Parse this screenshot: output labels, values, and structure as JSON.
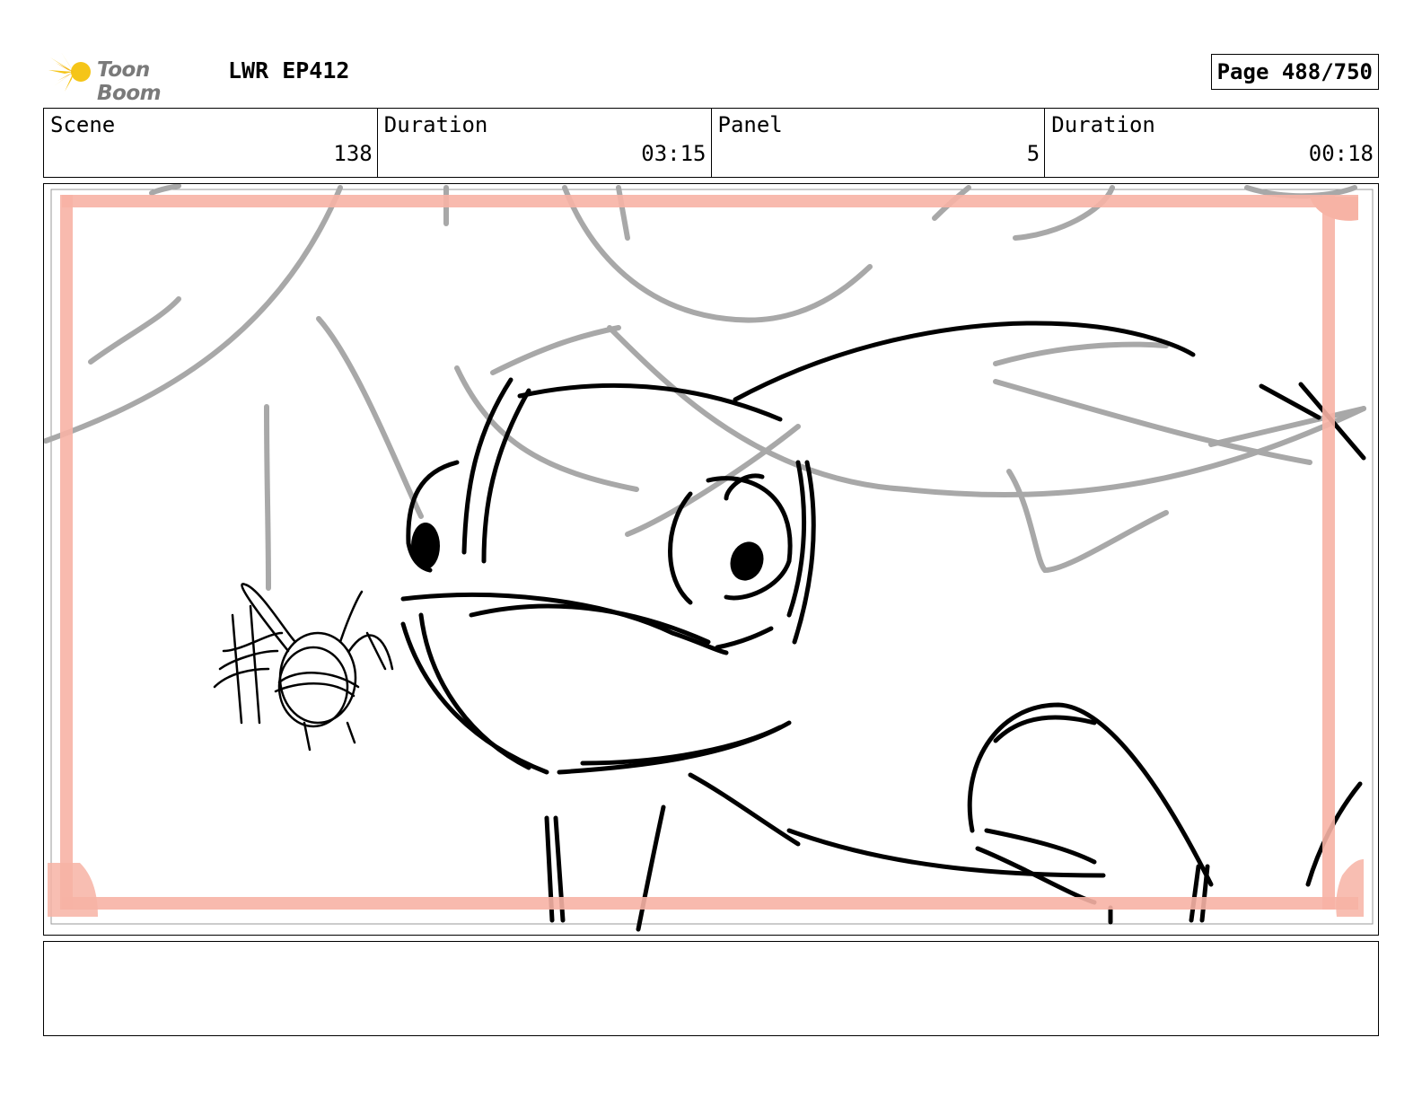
{
  "header": {
    "logo_text": "Toon Boom",
    "project": "LWR EP412",
    "page": "Page 488/750"
  },
  "info": [
    {
      "label": "Scene",
      "value": "138"
    },
    {
      "label": "Duration",
      "value": "03:15"
    },
    {
      "label": "Panel",
      "value": "5"
    },
    {
      "label": "Duration",
      "value": "00:18"
    }
  ],
  "notes": "",
  "colors": {
    "safe_frame": "#f7b3a5",
    "sketch_gray": "#a8a8a8",
    "sketch_black": "#000000",
    "logo_yellow": "#f5c518"
  }
}
